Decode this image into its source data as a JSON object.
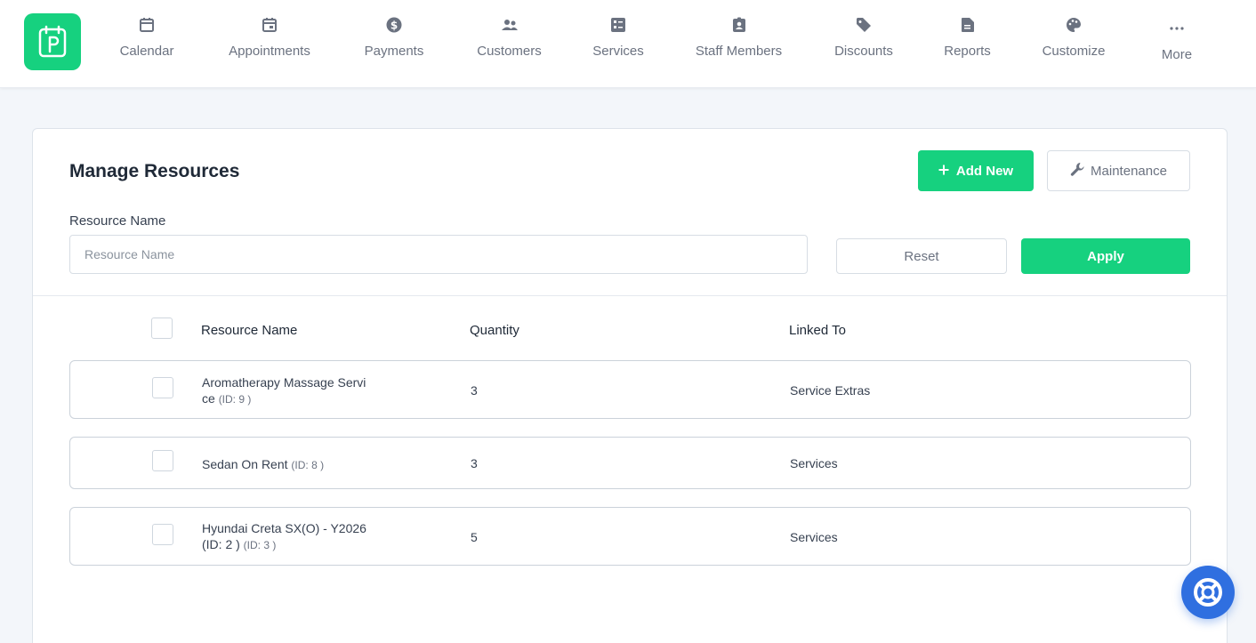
{
  "colors": {
    "accent": "#16d17f",
    "nav_text": "#6b7280",
    "help_button": "#2f6fe0",
    "page_bg": "#f3f6fa"
  },
  "nav": {
    "logo_icon": "app-logo-icon",
    "items": [
      {
        "label": "Calendar",
        "icon": "calendar-icon"
      },
      {
        "label": "Appointments",
        "icon": "calendar-event-icon"
      },
      {
        "label": "Payments",
        "icon": "dollar-circle-icon"
      },
      {
        "label": "Customers",
        "icon": "users-icon"
      },
      {
        "label": "Services",
        "icon": "list-icon"
      },
      {
        "label": "Staff Members",
        "icon": "id-badge-icon"
      },
      {
        "label": "Discounts",
        "icon": "tag-icon"
      },
      {
        "label": "Reports",
        "icon": "report-icon"
      },
      {
        "label": "Customize",
        "icon": "palette-icon"
      },
      {
        "label": "More",
        "icon": "more-dots-icon"
      }
    ]
  },
  "page": {
    "title": "Manage Resources",
    "add_new_label": "Add New",
    "maintenance_label": "Maintenance"
  },
  "filter": {
    "label": "Resource Name",
    "placeholder": "Resource Name",
    "value": "",
    "reset_label": "Reset",
    "apply_label": "Apply"
  },
  "table": {
    "headers": {
      "name": "Resource Name",
      "quantity": "Quantity",
      "linked_to": "Linked To"
    },
    "rows": [
      {
        "name": "Aromatherapy Massage Service",
        "id_text": "(ID: 9 )",
        "quantity": "3",
        "linked_to": "Service Extras",
        "checked": false
      },
      {
        "name": "Sedan On Rent",
        "id_text": "(ID: 8 )",
        "quantity": "3",
        "linked_to": "Services",
        "checked": false
      },
      {
        "name": "Hyundai Creta SX(O) - Y2026 (ID: 2 )",
        "id_text": "(ID: 3 )",
        "quantity": "5",
        "linked_to": "Services",
        "checked": false
      }
    ]
  },
  "help_button_icon": "lifebuoy-icon"
}
